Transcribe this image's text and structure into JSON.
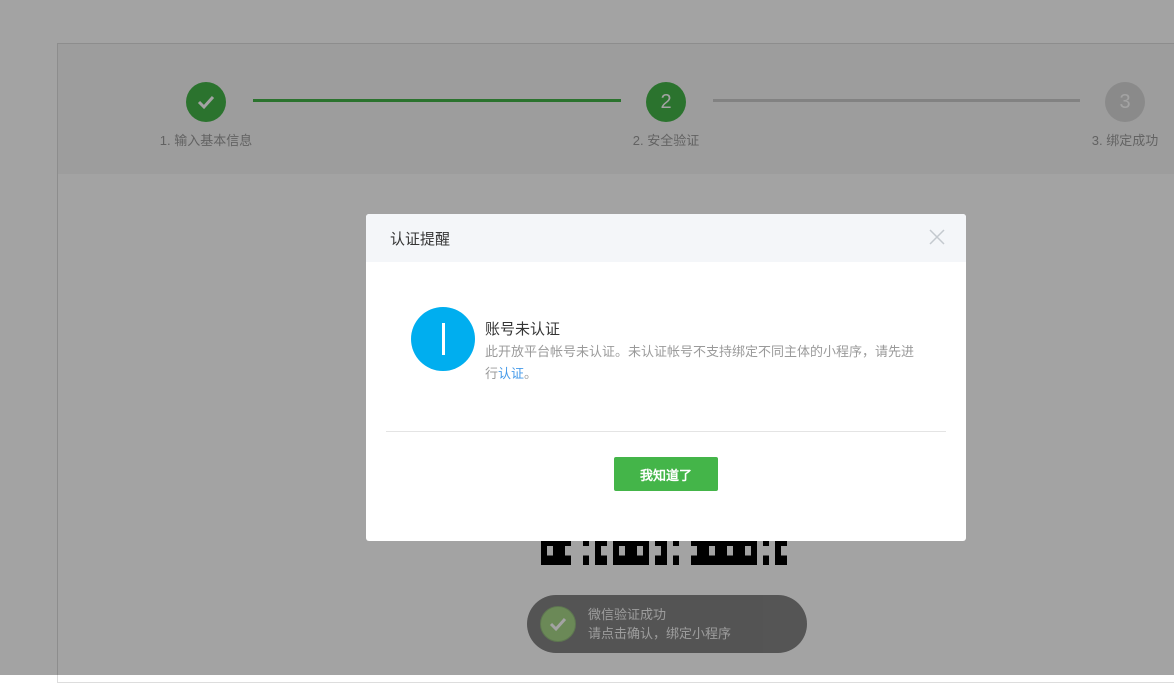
{
  "steps": [
    {
      "number": "1",
      "label": "1. 输入基本信息",
      "state": "done"
    },
    {
      "number": "2",
      "label": "2. 安全验证",
      "state": "current"
    },
    {
      "number": "3",
      "label": "3. 绑定成功",
      "state": "todo"
    }
  ],
  "scan_status": {
    "title": "微信验证成功",
    "subtitle": "请点击确认，绑定小程序"
  },
  "dialog": {
    "title": "认证提醒",
    "heading": "账号未认证",
    "desc_before": "此开放平台帐号未认证。未认证帐号不支持绑定不同主体的小程序，请先进行",
    "link": "认证",
    "desc_after": "。",
    "confirm": "我知道了"
  },
  "colors": {
    "accent": "#44b549",
    "info": "#00aeef",
    "link": "#459ae9"
  }
}
